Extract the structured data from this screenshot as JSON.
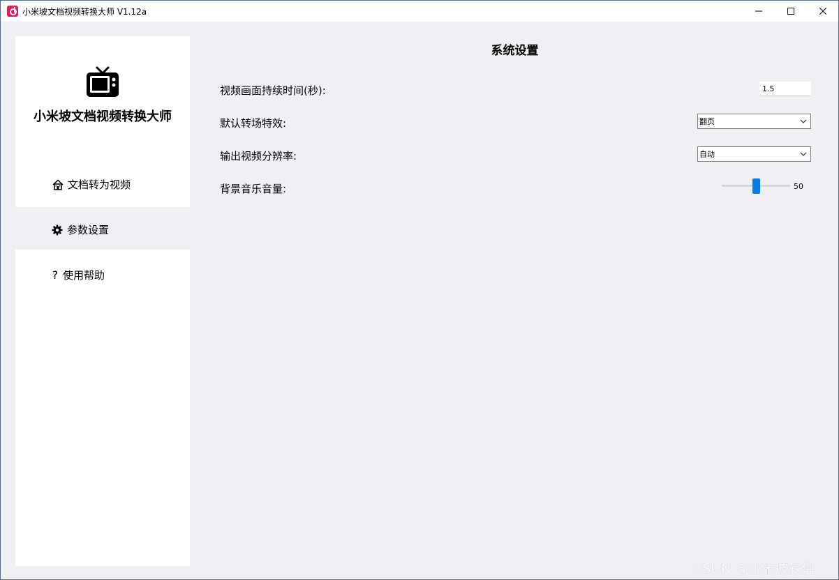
{
  "window": {
    "title": "小米坡文档视频转换大师 V1.12a"
  },
  "sidebar": {
    "app_name": "小米坡文档视频转换大师",
    "items": [
      {
        "label": "文档转为视频",
        "icon": "home-icon"
      },
      {
        "label": "参数设置",
        "icon": "gear-icon"
      },
      {
        "label": "使用帮助",
        "icon": "question-icon",
        "glyph": "?"
      }
    ]
  },
  "settings": {
    "title": "系统设置",
    "duration_label": "视频画面持续时间(秒):",
    "duration_value": "1.5",
    "transition_label": "默认转场特效:",
    "transition_value": "翻页",
    "resolution_label": "输出视频分辨率:",
    "resolution_value": "自动",
    "volume_label": "背景音乐音量:",
    "volume_value": "50"
  },
  "watermark": "CSDN @小米坡软件",
  "colors": {
    "accent": "#0a7ae0",
    "brand": "#e5195a",
    "panel_bg": "#f0f0f4"
  }
}
